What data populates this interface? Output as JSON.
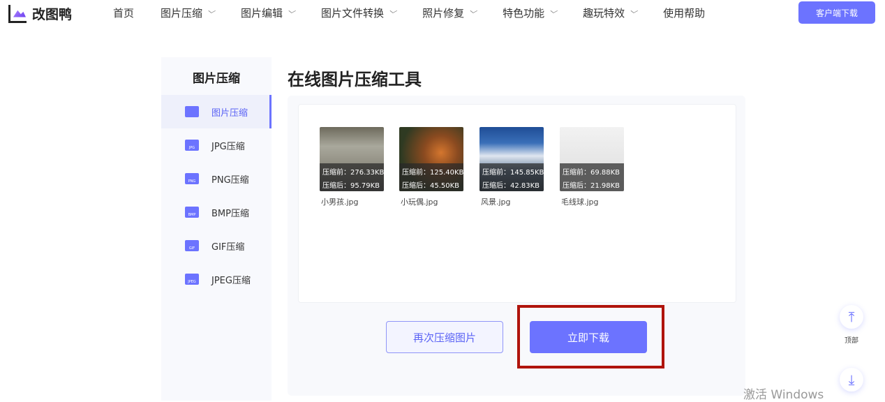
{
  "header": {
    "logo": "改图鸭",
    "nav": [
      {
        "label": "首页",
        "dropdown": false
      },
      {
        "label": "图片压缩",
        "dropdown": true
      },
      {
        "label": "图片编辑",
        "dropdown": true
      },
      {
        "label": "图片文件转换",
        "dropdown": true
      },
      {
        "label": "照片修复",
        "dropdown": true
      },
      {
        "label": "特色功能",
        "dropdown": true
      },
      {
        "label": "趣玩特效",
        "dropdown": true
      },
      {
        "label": "使用帮助",
        "dropdown": false
      }
    ],
    "client_download": "客户端下载"
  },
  "sidebar": {
    "title": "图片压缩",
    "items": [
      {
        "label": "图片压缩",
        "tag": ""
      },
      {
        "label": "JPG压缩",
        "tag": "JPG"
      },
      {
        "label": "PNG压缩",
        "tag": "PNG"
      },
      {
        "label": "BMP压缩",
        "tag": "BMP"
      },
      {
        "label": "GIF压缩",
        "tag": "GIF"
      },
      {
        "label": "JPEG压缩",
        "tag": "JPEG"
      }
    ]
  },
  "main": {
    "title": "在线图片压缩工具",
    "files": [
      {
        "name": "小男孩.jpg",
        "before": "压缩前：276.33KB",
        "after": "压缩后：95.79KB"
      },
      {
        "name": "小玩偶.jpg",
        "before": "压缩前：125.40KB",
        "after": "压缩后：45.50KB"
      },
      {
        "name": "风景.jpg",
        "before": "压缩前：145.85KB",
        "after": "压缩后：42.83KB"
      },
      {
        "name": "毛线球.jpg",
        "before": "压缩前：69.88KB",
        "after": "压缩后：21.98KB"
      }
    ],
    "compress_again": "再次压缩图片",
    "download_now": "立即下载"
  },
  "float": {
    "top_label": "顶部"
  },
  "watermark": "激活 Windows",
  "colors": {
    "accent": "#6c73ff",
    "highlight": "#b0140c"
  }
}
